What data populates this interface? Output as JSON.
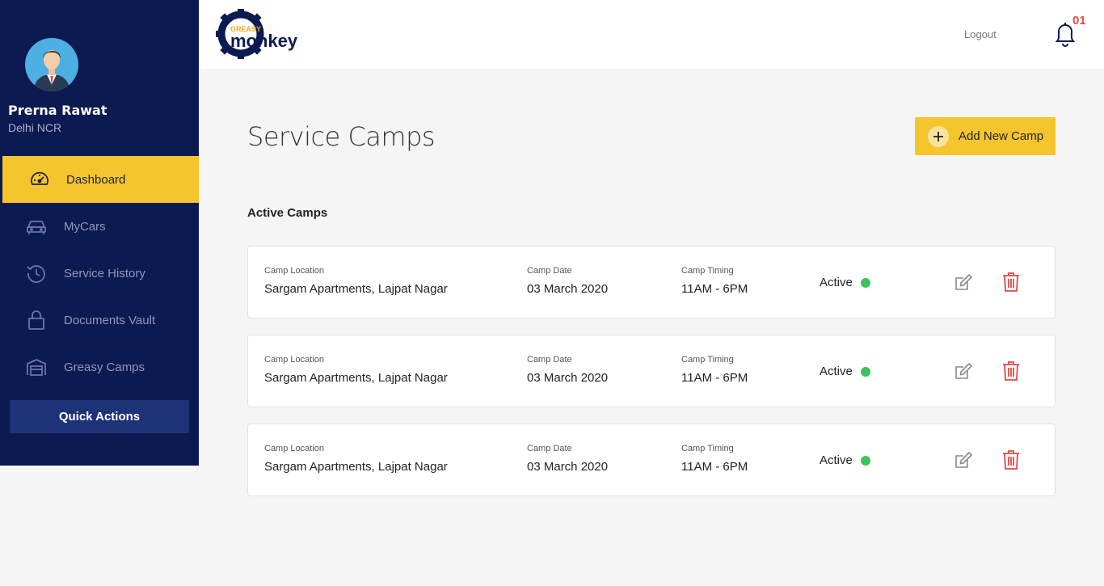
{
  "user": {
    "name": "Prerna Rawat",
    "location": "Delhi NCR"
  },
  "nav": [
    {
      "label": "Dashboard",
      "icon": "speedometer-icon",
      "active": true
    },
    {
      "label": "MyCars",
      "icon": "car-icon",
      "active": false
    },
    {
      "label": "Service History",
      "icon": "history-icon",
      "active": false
    },
    {
      "label": "Documents Vault",
      "icon": "lock-icon",
      "active": false
    },
    {
      "label": "Greasy Camps",
      "icon": "garage-icon",
      "active": false
    }
  ],
  "quick_actions_label": "Quick Actions",
  "header": {
    "logo": {
      "top_text": "GREASY",
      "bottom_text": "monkey"
    },
    "logout_label": "Logout",
    "notification_count": "01"
  },
  "page": {
    "title": "Service Camps",
    "add_button_label": "Add New Camp",
    "section_title": "Active Camps"
  },
  "camps": [
    {
      "location_label": "Camp Location",
      "location": "Sargam Apartments, Lajpat Nagar",
      "date_label": "Camp Date",
      "date": "03 March 2020",
      "timing_label": "Camp Timing",
      "timing": "11AM - 6PM",
      "status": "Active"
    },
    {
      "location_label": "Camp Location",
      "location": "Sargam Apartments, Lajpat Nagar",
      "date_label": "Camp Date",
      "date": "03 March 2020",
      "timing_label": "Camp Timing",
      "timing": "11AM - 6PM",
      "status": "Active"
    },
    {
      "location_label": "Camp Location",
      "location": "Sargam Apartments, Lajpat Nagar",
      "date_label": "Camp Date",
      "date": "03 March 2020",
      "timing_label": "Camp Timing",
      "timing": "11AM - 6PM",
      "status": "Active"
    }
  ],
  "colors": {
    "sidebar_bg": "#0c1a52",
    "accent_yellow": "#f5c52e",
    "quick_actions_bg": "#1e3278",
    "status_green": "#3cc25a",
    "delete_red": "#e04848",
    "notification_red": "#e44c4c"
  }
}
